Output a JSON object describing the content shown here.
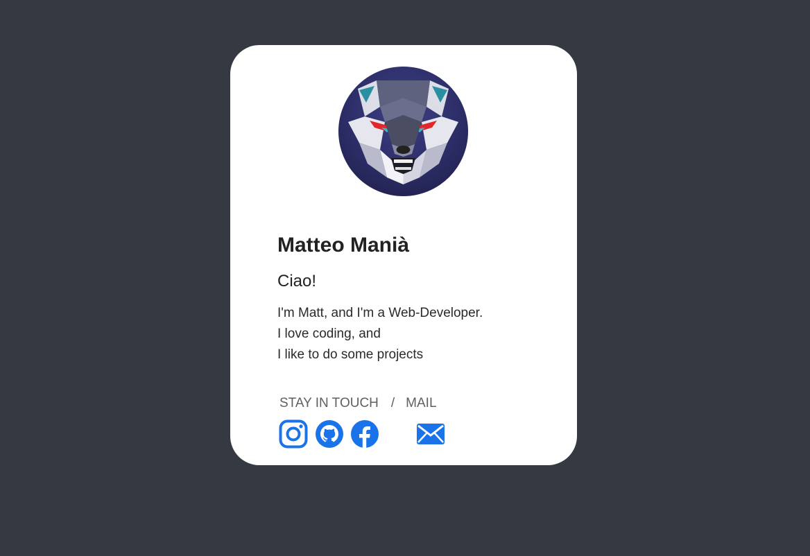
{
  "profile": {
    "name": "Matteo Manià",
    "greeting": "Ciao!",
    "bio_lines": [
      "I'm Matt, and I'm a Web-Developer.",
      "I love coding, and",
      "I like to do some projects"
    ],
    "avatar_icon": "wolf-avatar"
  },
  "contact": {
    "stay_in_touch": "STAY IN TOUCH",
    "separator": "/",
    "mail": "MAIL"
  },
  "social": {
    "items": [
      {
        "icon": "instagram-icon"
      },
      {
        "icon": "github-icon"
      },
      {
        "icon": "facebook-icon"
      },
      {
        "icon": "mail-icon"
      }
    ],
    "accent_color": "#1a73e8"
  },
  "colors": {
    "background": "#353941",
    "card": "#ffffff",
    "text": "#222222",
    "muted": "#5f5f5f"
  }
}
